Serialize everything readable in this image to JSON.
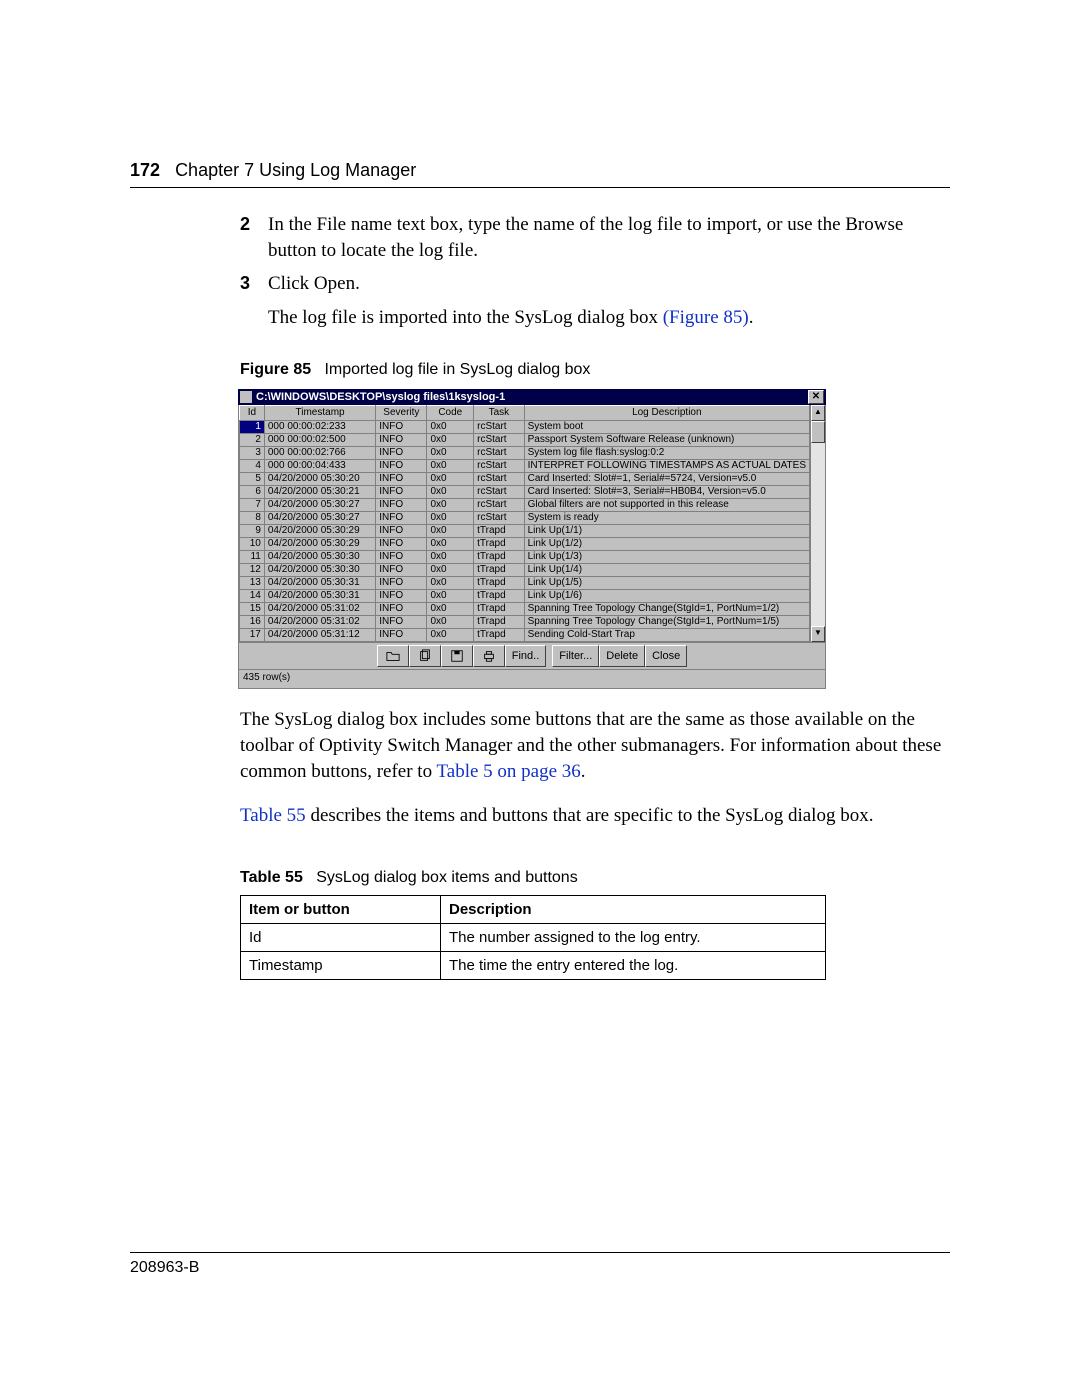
{
  "header": {
    "page_number": "172",
    "chapter": "Chapter 7  Using Log Manager"
  },
  "steps": [
    {
      "num": "2",
      "text": "In the File name text box, type the name of the log file to import, or use the Browse button to locate the log file."
    },
    {
      "num": "3",
      "text": "Click Open."
    }
  ],
  "after_step_text": "The log file is imported into the SysLog dialog box ",
  "figure_ref_text": "(Figure 85)",
  "figure_caption_label": "Figure 85",
  "figure_caption_text": "Imported log file in SysLog dialog box",
  "window": {
    "title": "C:\\WINDOWS\\DESKTOP\\syslog files\\1ksyslog-1",
    "columns": [
      "Id",
      "Timestamp",
      "Severity",
      "Code",
      "Task",
      "Log Description"
    ],
    "rows": [
      {
        "id": "1",
        "ts": "000 00:00:02:233",
        "sev": "INFO",
        "code": "0x0",
        "task": "rcStart",
        "desc": "System boot"
      },
      {
        "id": "2",
        "ts": "000 00:00:02:500",
        "sev": "INFO",
        "code": "0x0",
        "task": "rcStart",
        "desc": "Passport System Software Release (unknown)"
      },
      {
        "id": "3",
        "ts": "000 00:00:02:766",
        "sev": "INFO",
        "code": "0x0",
        "task": "rcStart",
        "desc": "System log file flash:syslog:0:2"
      },
      {
        "id": "4",
        "ts": "000 00:00:04:433",
        "sev": "INFO",
        "code": "0x0",
        "task": "rcStart",
        "desc": "INTERPRET FOLLOWING TIMESTAMPS AS ACTUAL DATES"
      },
      {
        "id": "5",
        "ts": "04/20/2000 05:30:20",
        "sev": "INFO",
        "code": "0x0",
        "task": "rcStart",
        "desc": "Card Inserted: Slot#=1, Serial#=5724, Version=v5.0"
      },
      {
        "id": "6",
        "ts": "04/20/2000 05:30:21",
        "sev": "INFO",
        "code": "0x0",
        "task": "rcStart",
        "desc": "Card Inserted: Slot#=3, Serial#=HB0B4, Version=v5.0"
      },
      {
        "id": "7",
        "ts": "04/20/2000 05:30:27",
        "sev": "INFO",
        "code": "0x0",
        "task": "rcStart",
        "desc": "Global filters are not supported in this release"
      },
      {
        "id": "8",
        "ts": "04/20/2000 05:30:27",
        "sev": "INFO",
        "code": "0x0",
        "task": "rcStart",
        "desc": "System is ready"
      },
      {
        "id": "9",
        "ts": "04/20/2000 05:30:29",
        "sev": "INFO",
        "code": "0x0",
        "task": "tTrapd",
        "desc": "Link Up(1/1)"
      },
      {
        "id": "10",
        "ts": "04/20/2000 05:30:29",
        "sev": "INFO",
        "code": "0x0",
        "task": "tTrapd",
        "desc": "Link Up(1/2)"
      },
      {
        "id": "11",
        "ts": "04/20/2000 05:30:30",
        "sev": "INFO",
        "code": "0x0",
        "task": "tTrapd",
        "desc": "Link Up(1/3)"
      },
      {
        "id": "12",
        "ts": "04/20/2000 05:30:30",
        "sev": "INFO",
        "code": "0x0",
        "task": "tTrapd",
        "desc": "Link Up(1/4)"
      },
      {
        "id": "13",
        "ts": "04/20/2000 05:30:31",
        "sev": "INFO",
        "code": "0x0",
        "task": "tTrapd",
        "desc": "Link Up(1/5)"
      },
      {
        "id": "14",
        "ts": "04/20/2000 05:30:31",
        "sev": "INFO",
        "code": "0x0",
        "task": "tTrapd",
        "desc": "Link Up(1/6)"
      },
      {
        "id": "15",
        "ts": "04/20/2000 05:31:02",
        "sev": "INFO",
        "code": "0x0",
        "task": "tTrapd",
        "desc": "Spanning Tree Topology Change(StgId=1, PortNum=1/2)"
      },
      {
        "id": "16",
        "ts": "04/20/2000 05:31:02",
        "sev": "INFO",
        "code": "0x0",
        "task": "tTrapd",
        "desc": "Spanning Tree Topology Change(StgId=1, PortNum=1/5)"
      },
      {
        "id": "17",
        "ts": "04/20/2000 05:31:12",
        "sev": "INFO",
        "code": "0x0",
        "task": "tTrapd",
        "desc": "Sending Cold-Start Trap"
      }
    ],
    "buttons": {
      "find": "Find..",
      "filter": "Filter...",
      "delete": "Delete",
      "close": "Close"
    },
    "status": "435 row(s)"
  },
  "para1_pre": "The SysLog dialog box includes some buttons that are the same as those available on the toolbar of Optivity Switch Manager and the other submanagers. For information about these common buttons, refer to ",
  "para1_link": "Table 5 on page 36",
  "para1_post": ".",
  "para2_link": "Table 55",
  "para2_post": " describes the items and buttons that are specific to the SysLog dialog box.",
  "table_caption_label": "Table 55",
  "table_caption_text": "SysLog dialog box items and buttons",
  "desc_table": {
    "headers": [
      "Item or button",
      "Description"
    ],
    "rows": [
      {
        "item": "Id",
        "desc": "The number assigned to the log entry."
      },
      {
        "item": "Timestamp",
        "desc": "The time the entry entered the log."
      }
    ]
  },
  "footer": "208963-B"
}
